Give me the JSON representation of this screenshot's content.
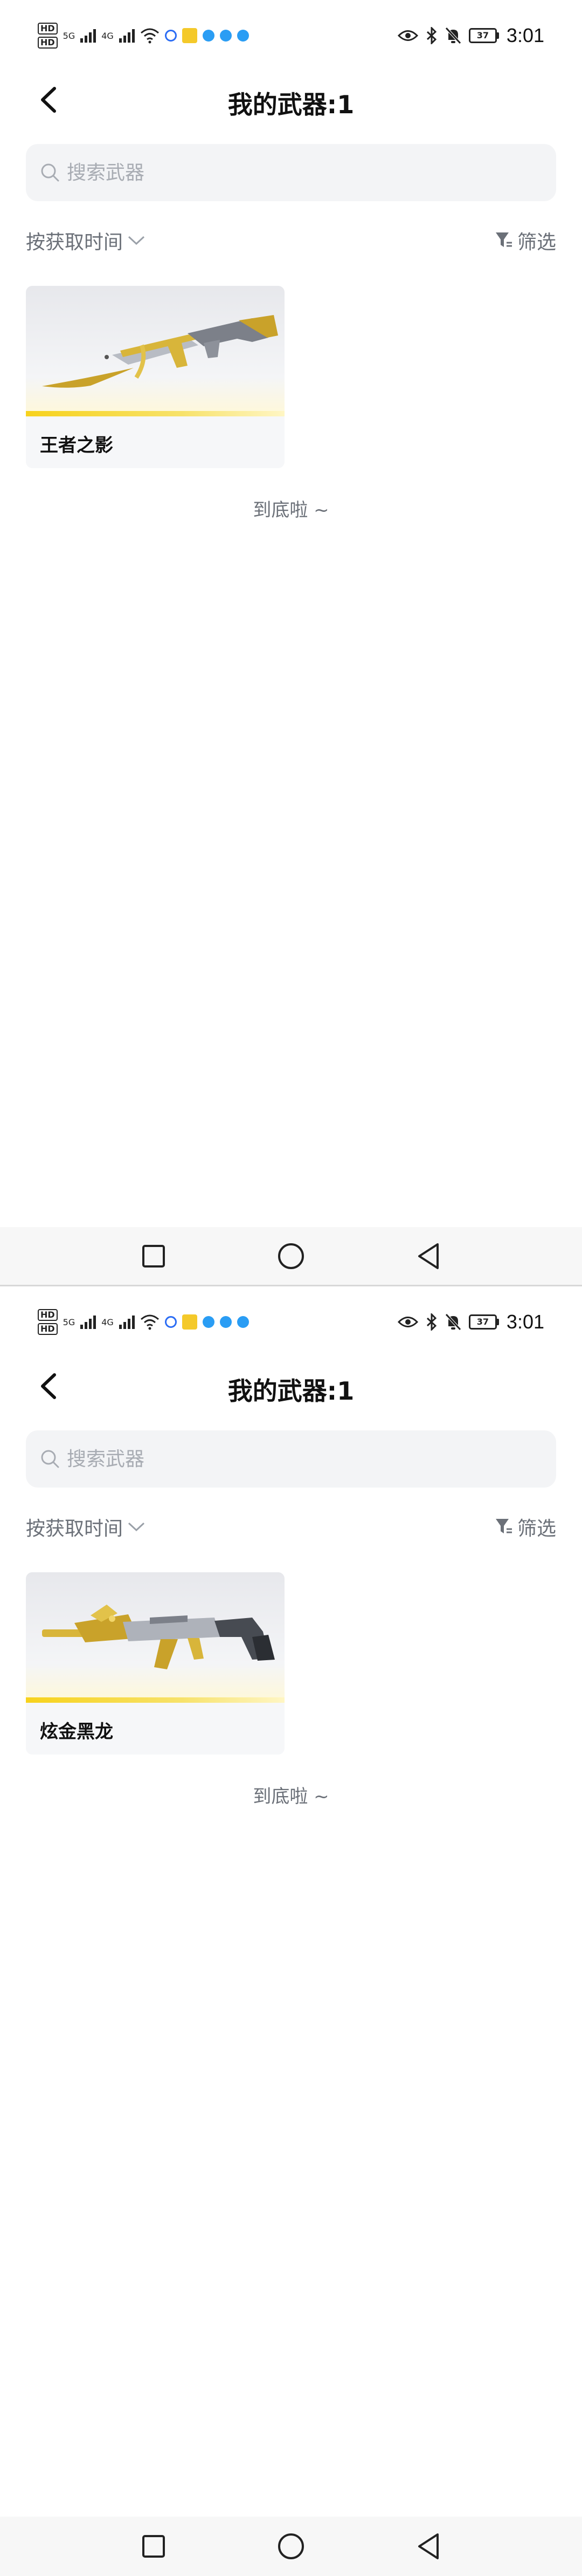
{
  "screens": [
    {
      "status": {
        "hd1": "HD",
        "hd2": "HD",
        "net1": "5G",
        "net2": "4G",
        "battery": "37",
        "time": "3:01"
      },
      "header": {
        "title": "我的武器:1"
      },
      "search": {
        "placeholder": "搜索武器",
        "value": ""
      },
      "sort": {
        "label": "按获取时间"
      },
      "filter": {
        "label": "筛选"
      },
      "weapons": [
        {
          "name": "王者之影",
          "image_icon": "rifle-ak-gold-icon"
        }
      ],
      "footer_tip": "到底啦 ~"
    },
    {
      "status": {
        "hd1": "HD",
        "hd2": "HD",
        "net1": "5G",
        "net2": "4G",
        "battery": "37",
        "time": "3:01"
      },
      "header": {
        "title": "我的武器:1"
      },
      "search": {
        "placeholder": "搜索武器",
        "value": ""
      },
      "sort": {
        "label": "按获取时间"
      },
      "filter": {
        "label": "筛选"
      },
      "weapons": [
        {
          "name": "炫金黑龙",
          "image_icon": "rifle-m4-gold-icon"
        }
      ],
      "footer_tip": "到底啦 ~"
    }
  ],
  "colors": {
    "accent_yellow": "#f7d21c",
    "muted_text": "#6b7078",
    "search_bg": "#f3f4f6"
  }
}
